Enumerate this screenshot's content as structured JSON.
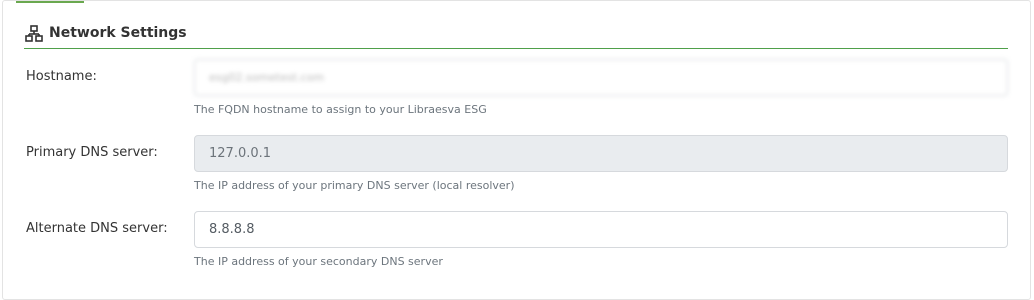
{
  "section": {
    "title": "Network Settings",
    "icon": "network-icon"
  },
  "fields": {
    "hostname": {
      "label": "Hostname:",
      "value": "esg02.sometest.com",
      "help": "The FQDN hostname to assign to your Libraesva ESG"
    },
    "primary_dns": {
      "label": "Primary DNS server:",
      "value": "127.0.0.1",
      "help": "The IP address of your primary DNS server (local resolver)"
    },
    "alternate_dns": {
      "label": "Alternate DNS server:",
      "value": "8.8.8.8",
      "help": "The IP address of your secondary DNS server"
    }
  },
  "colors": {
    "accent": "#4fa04a",
    "readonly_bg": "#e9ecef"
  }
}
